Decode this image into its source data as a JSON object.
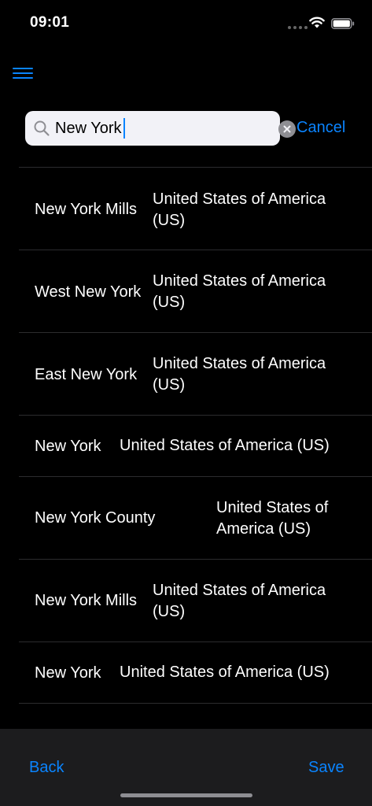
{
  "status_bar": {
    "time": "09:01"
  },
  "search": {
    "value": "New York",
    "placeholder": "",
    "cancel_label": "Cancel"
  },
  "results": [
    {
      "city": "New York Mills",
      "country": "United States of America (US)"
    },
    {
      "city": "West New York",
      "country": "United States of America (US)"
    },
    {
      "city": "East New York",
      "country": "United States of America (US)"
    },
    {
      "city": "New York",
      "country": "United States of America (US)"
    },
    {
      "city": "New York County",
      "country": "United States of America (US)"
    },
    {
      "city": "New York Mills",
      "country": "United States of America (US)"
    },
    {
      "city": "New York",
      "country": "United States of America (US)"
    }
  ],
  "bottom_bar": {
    "back_label": "Back",
    "save_label": "Save"
  },
  "colors": {
    "accent": "#0a84ff",
    "background": "#000000",
    "divider": "#2c2c2e",
    "toolbar": "#1c1c1e"
  },
  "icons": {
    "menu": "hamburger-menu-icon",
    "search": "magnifying-glass-icon",
    "clear": "clear-x-circle-icon",
    "wifi": "wifi-icon",
    "battery": "battery-icon"
  }
}
